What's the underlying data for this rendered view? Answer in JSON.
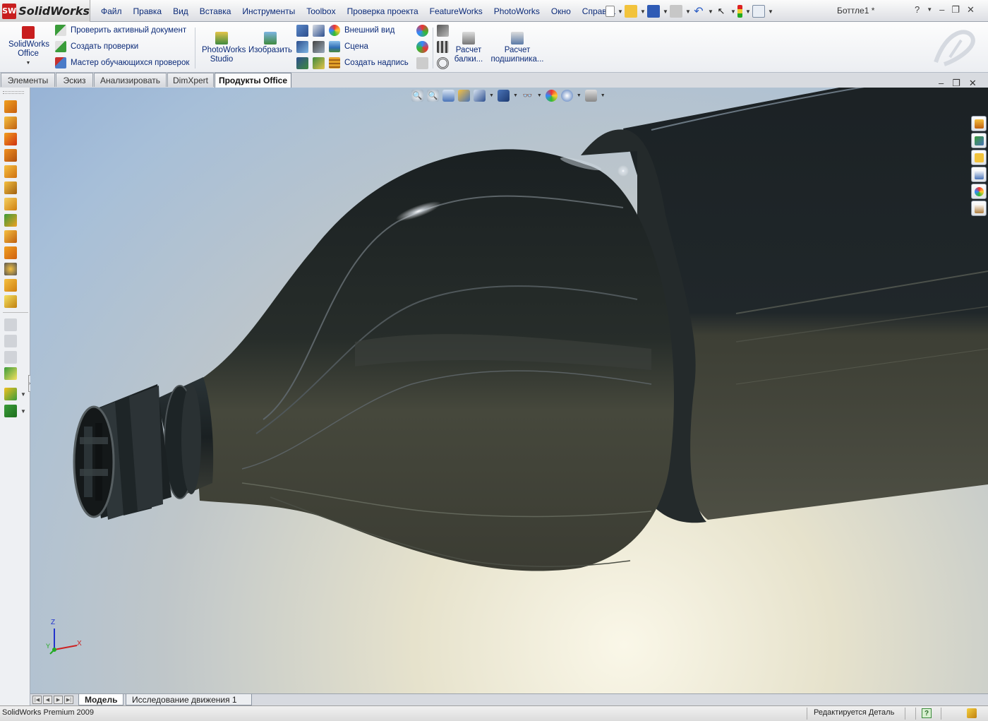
{
  "app": {
    "brand_badge": "SW",
    "brand": "SolidWorks",
    "doc_title": "Боттле1 *"
  },
  "menu": [
    "Файл",
    "Правка",
    "Вид",
    "Вставка",
    "Инструменты",
    "Toolbox",
    "Проверка проекта",
    "FeatureWorks",
    "PhotoWorks",
    "Окно",
    "Справка"
  ],
  "ribbon": {
    "swoffice": "SolidWorks Office",
    "check_active": "Проверить активный документ",
    "create_checks": "Создать проверки",
    "wizard": "Мастер обучающихся проверок",
    "photoworks": "PhotoWorks Studio",
    "render": "Изобразить",
    "appearance": "Внешний вид",
    "scene": "Сцена",
    "decal": "Создать надпись",
    "beam": "Расчет балки...",
    "bearing": "Расчет подшипника..."
  },
  "tabs": [
    "Элементы",
    "Эскиз",
    "Анализировать",
    "DimXpert",
    "Продукты Office"
  ],
  "active_tab": "Продукты Office",
  "bottom_tabs": [
    "Модель",
    "Исследование движения 1"
  ],
  "active_bottom_tab": "Модель",
  "status": {
    "left": "SolidWorks Premium 2009",
    "right": "Редактируется Деталь"
  },
  "triad": {
    "z": "Z",
    "x": "X",
    "y": "Y"
  },
  "colors": {
    "accent": "#c81e1e",
    "menu_text": "#0b2a78",
    "bottle": "#1e2426"
  }
}
